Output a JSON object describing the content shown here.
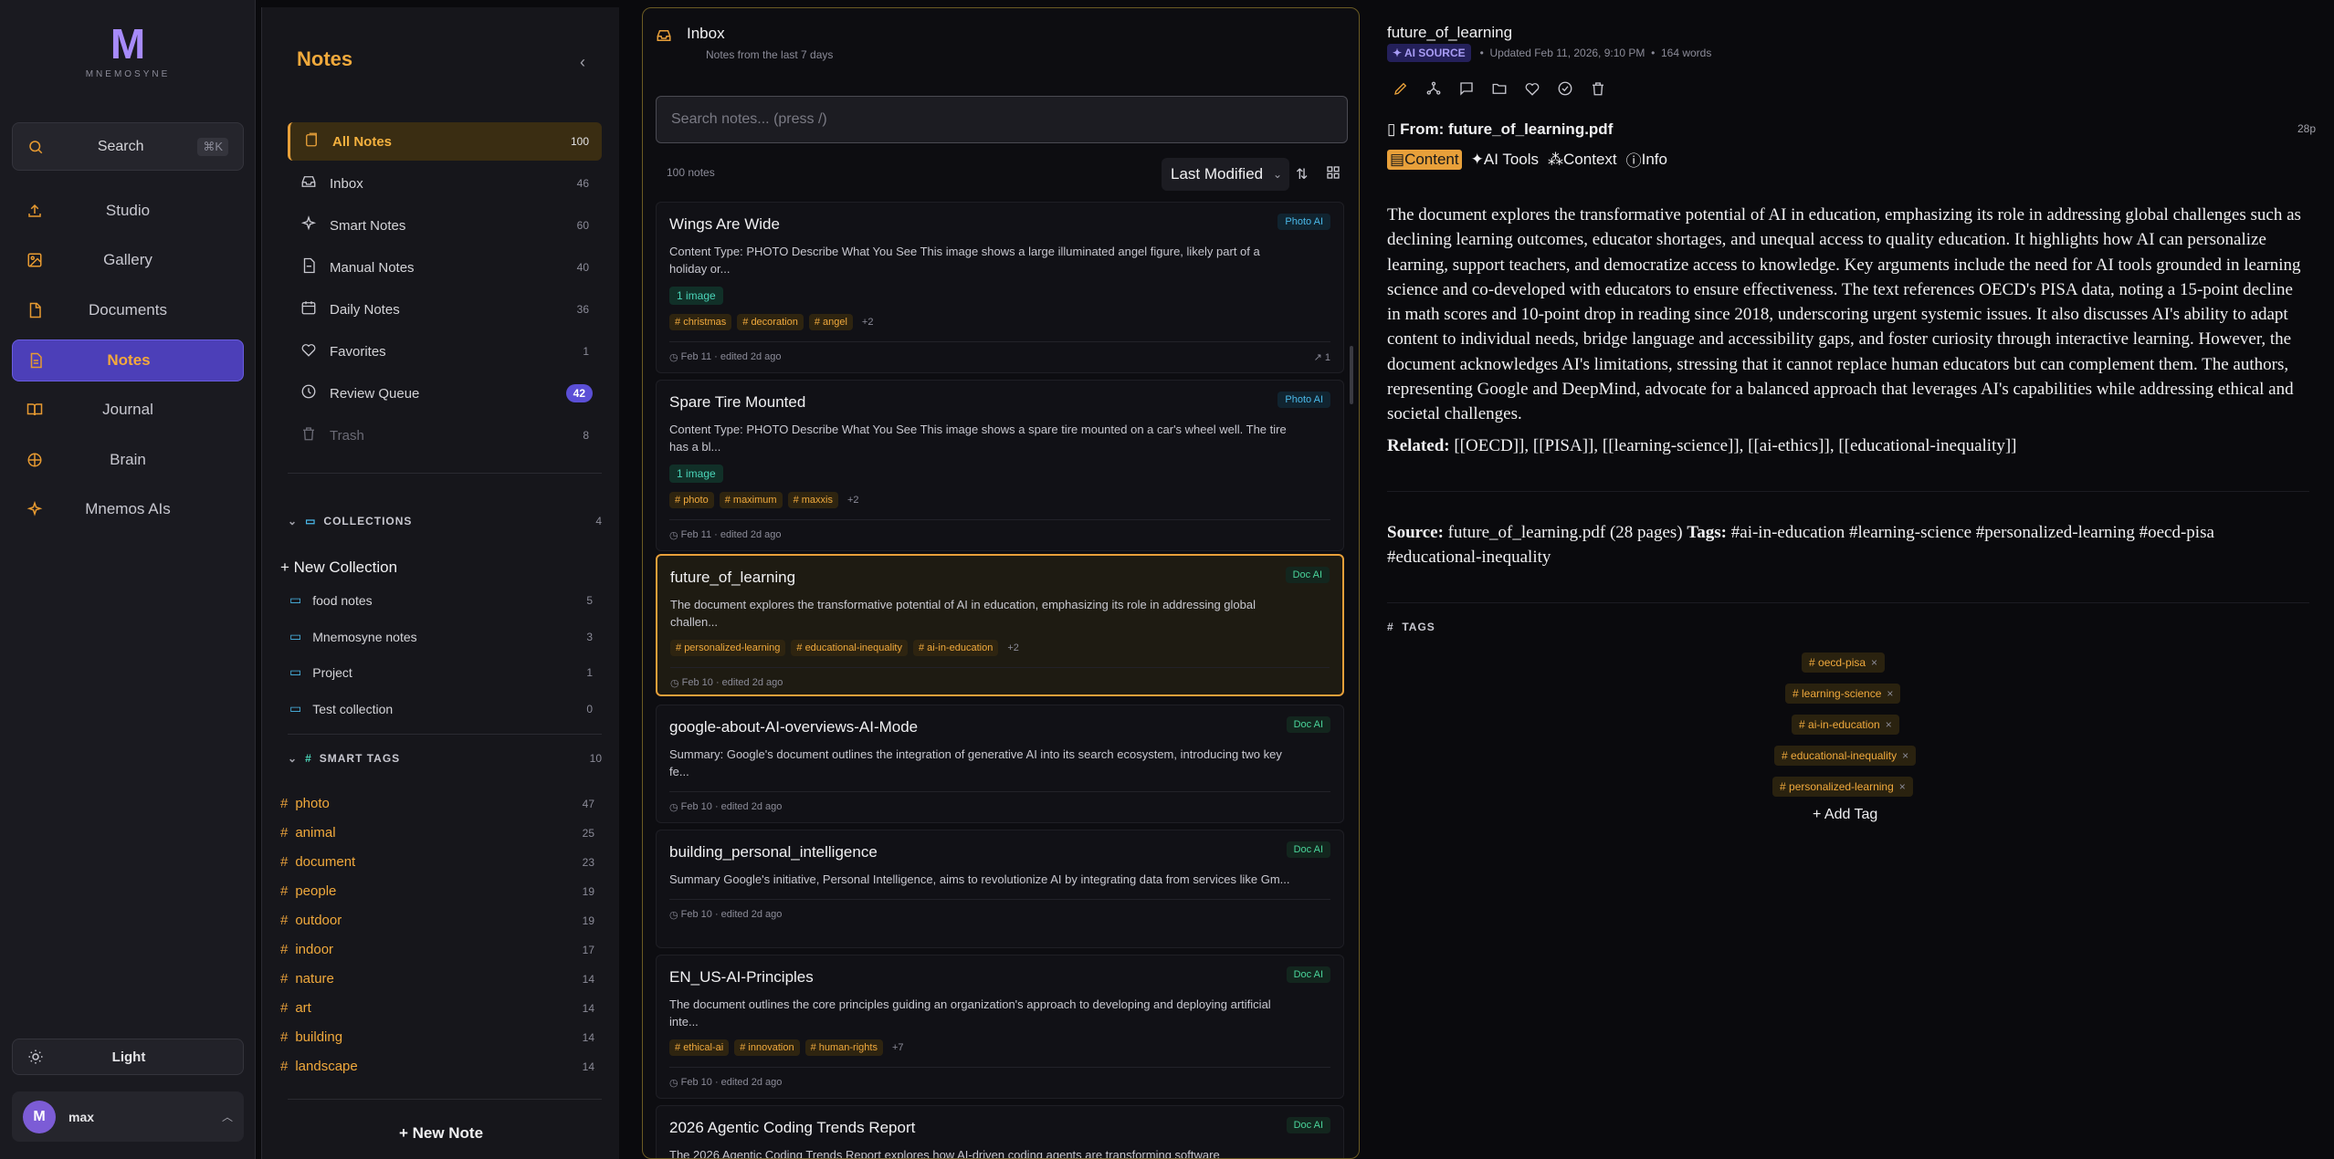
{
  "nav": {
    "logo": "M",
    "brand": "MNEMOSYNE",
    "search": "Search",
    "search_kbd": "⌘K",
    "items": [
      {
        "label": "Studio",
        "icon": "upload-icon"
      },
      {
        "label": "Gallery",
        "icon": "image-icon"
      },
      {
        "label": "Documents",
        "icon": "document-icon"
      },
      {
        "label": "Notes",
        "icon": "notes-icon",
        "active": true
      },
      {
        "label": "Journal",
        "icon": "book-icon"
      },
      {
        "label": "Brain",
        "icon": "brain-icon"
      },
      {
        "label": "Mnemos AIs",
        "icon": "sparkle-icon"
      }
    ],
    "theme": "Light",
    "user": {
      "initial": "M",
      "name": "max"
    }
  },
  "sidebar": {
    "title": "Notes",
    "filters": [
      {
        "label": "All Notes",
        "count": "100"
      },
      {
        "label": "Inbox",
        "count": "46"
      },
      {
        "label": "Smart Notes",
        "count": "60"
      },
      {
        "label": "Manual Notes",
        "count": "40"
      },
      {
        "label": "Daily Notes",
        "count": "36"
      },
      {
        "label": "Favorites",
        "count": "1"
      },
      {
        "label": "Review Queue",
        "count": "42"
      },
      {
        "label": "Trash",
        "count": "8"
      }
    ],
    "collections_header": "COLLECTIONS",
    "collections_count": "4",
    "new_collection": "New Collection",
    "collections": [
      {
        "label": "food notes",
        "count": "5"
      },
      {
        "label": "Mnemosyne notes",
        "count": "3"
      },
      {
        "label": "Project",
        "count": "1"
      },
      {
        "label": "Test collection",
        "count": "0"
      }
    ],
    "smart_tags_header": "SMART TAGS",
    "smart_tags_count": "10",
    "tags": [
      {
        "label": "photo",
        "count": "47"
      },
      {
        "label": "animal",
        "count": "25"
      },
      {
        "label": "document",
        "count": "23"
      },
      {
        "label": "people",
        "count": "19"
      },
      {
        "label": "outdoor",
        "count": "19"
      },
      {
        "label": "indoor",
        "count": "17"
      },
      {
        "label": "nature",
        "count": "14"
      },
      {
        "label": "art",
        "count": "14"
      },
      {
        "label": "building",
        "count": "14"
      },
      {
        "label": "landscape",
        "count": "14"
      }
    ],
    "new_note": "New Note"
  },
  "list": {
    "title": "Inbox",
    "subtitle": "Notes from the last 7 days",
    "search_placeholder": "Search notes... (press /)",
    "count": "100 notes",
    "sort": "Last Modified",
    "cards": [
      {
        "title": "Wings Are Wide",
        "badge": "Photo AI",
        "snippet": "Content Type: PHOTO Describe What You See This image shows a large illuminated angel figure, likely part of a holiday or...",
        "images": "1 image",
        "tags": [
          "christmas",
          "decoration",
          "angel"
        ],
        "more": "+2",
        "date": "Feb 11 · edited 2d ago",
        "links": "1"
      },
      {
        "title": "Spare Tire Mounted",
        "badge": "Photo AI",
        "snippet": "Content Type: PHOTO Describe What You See This image shows a spare tire mounted on a car's wheel well. The tire has a bl...",
        "images": "1 image",
        "tags": [
          "photo",
          "maximum",
          "maxxis"
        ],
        "more": "+2",
        "date": "Feb 11 · edited 2d ago"
      },
      {
        "title": "future_of_learning",
        "badge": "Doc AI",
        "snippet": "The document explores the transformative potential of AI in education, emphasizing its role in addressing global challen...",
        "tags": [
          "personalized-learning",
          "educational-inequality",
          "ai-in-education"
        ],
        "more": "+2",
        "date": "Feb 10 · edited 2d ago"
      },
      {
        "title": "google-about-AI-overviews-AI-Mode",
        "badge": "Doc AI",
        "snippet": "Summary: Google's document outlines the integration of generative AI into its search ecosystem, introducing two key fe...",
        "date": "Feb 10 · edited 2d ago"
      },
      {
        "title": "building_personal_intelligence",
        "badge": "Doc AI",
        "snippet": "Summary Google's initiative, Personal Intelligence, aims to revolutionize AI by integrating data from services like Gm...",
        "date": "Feb 10 · edited 2d ago"
      },
      {
        "title": "EN_US-AI-Principles",
        "badge": "Doc AI",
        "snippet": "The document outlines the core principles guiding an organization's approach to developing and deploying artificial inte...",
        "tags": [
          "ethical-ai",
          "innovation",
          "human-rights"
        ],
        "more": "+7",
        "date": "Feb 10 · edited 2d ago"
      },
      {
        "title": "2026 Agentic Coding Trends Report",
        "badge": "Doc AI",
        "snippet": "The 2026 Agentic Coding Trends Report explores how AI-driven coding agents are transforming software"
      }
    ]
  },
  "detail": {
    "title": "future_of_learning",
    "source_badge": "AI SOURCE",
    "updated": "Updated Feb 11, 2026, 9:10 PM",
    "words": "164 words",
    "from": "From: future_of_learning.pdf",
    "pages": "28p",
    "tabs": [
      "Content",
      "AI Tools",
      "Context",
      "Info"
    ],
    "body": "The document explores the transformative potential of AI in education, emphasizing its role in addressing global challenges such as declining learning outcomes, educator shortages, and unequal access to quality education. It highlights how AI can personalize learning, support teachers, and democratize access to knowledge. Key arguments include the need for AI tools grounded in learning science and co-developed with educators to ensure effectiveness. The text references OECD's PISA data, noting a 15-point decline in math scores and 10-point drop in reading since 2018, underscoring urgent systemic issues. It also discusses AI's ability to adapt content to individual needs, bridge language and accessibility gaps, and foster curiosity through interactive learning. However, the document acknowledges AI's limitations, stressing that it cannot replace human educators but can complement them. The authors, representing Google and DeepMind, advocate for a balanced approach that leverages AI's capabilities while addressing ethical and societal challenges.",
    "related_label": "Related:",
    "related": "[[OECD]], [[PISA]], [[learning-science]], [[ai-ethics]], [[educational-inequality]]",
    "source_label": "Source:",
    "source": "future_of_learning.pdf (28 pages)",
    "tags_label": "Tags:",
    "tags_line": "#ai-in-education #learning-science #personalized-learning #oecd-pisa #educational-inequality",
    "tags_header": "TAGS",
    "tags": [
      "oecd-pisa",
      "learning-science",
      "ai-in-education",
      "educational-inequality",
      "personalized-learning"
    ],
    "add_tag": "+ Add Tag"
  }
}
